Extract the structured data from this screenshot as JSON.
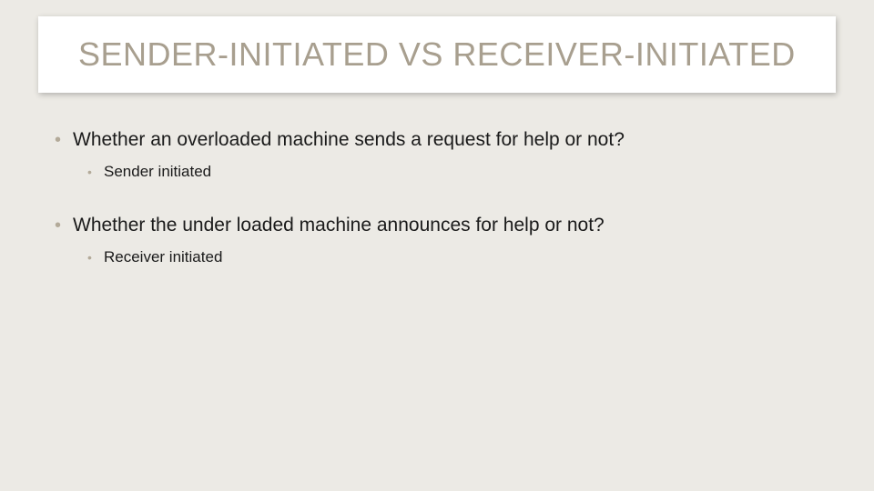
{
  "title": "SENDER-INITIATED VS RECEIVER-INITIATED",
  "items": [
    {
      "text": "Whether an overloaded machine sends a request for help or not?",
      "sub": [
        {
          "text": "Sender initiated"
        }
      ]
    },
    {
      "text": "Whether the under loaded machine announces for help or not?",
      "sub": [
        {
          "text": "Receiver initiated"
        }
      ]
    }
  ]
}
